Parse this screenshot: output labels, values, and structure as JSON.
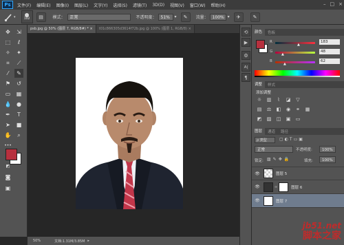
{
  "app": {
    "logo": "Ps"
  },
  "menu": [
    "文件(F)",
    "编辑(E)",
    "图像(I)",
    "图层(L)",
    "文字(Y)",
    "选择(S)",
    "滤镜(T)",
    "3D(D)",
    "视图(V)",
    "窗口(W)",
    "帮助(H)"
  ],
  "window_controls": [
    "–",
    "□",
    "×"
  ],
  "options": {
    "brush_size": "102",
    "mode_label": "模式：",
    "mode_value": "正常",
    "opacity_label": "不透明度：",
    "opacity_value": "51%",
    "flow_label": "流量：",
    "flow_value": "100%"
  },
  "tabs": [
    {
      "label": "psb.jpg @ 50% (图层 7, RGB/8#) *",
      "close": "×"
    },
    {
      "label": "t01c866305d3614f72b.jpg @ 100% (图层 1, RGB/8)",
      "close": "×"
    }
  ],
  "status": {
    "zoom": "50%",
    "doc": "文档:1.31M/3.85M"
  },
  "color_panel": {
    "tabs": [
      "颜色",
      "色板"
    ],
    "R": {
      "label": "R",
      "value": "183"
    },
    "G": {
      "label": "G",
      "value": "48"
    },
    "B": {
      "label": "B",
      "value": "62"
    },
    "foreground": "#b7303e"
  },
  "adjust_panel": {
    "tabs": [
      "调整",
      "样式"
    ],
    "title": "添加调整"
  },
  "layers_panel": {
    "tabs": [
      "图层",
      "通道",
      "路径"
    ],
    "kind_label": "ρ 类型",
    "blend_mode": "正常",
    "opacity_label": "不透明度:",
    "opacity_value": "100%",
    "lock_label": "锁定:",
    "fill_label": "填充:",
    "fill_value": "100%",
    "layers": [
      {
        "name": "图层 5"
      },
      {
        "name": "图层 6"
      },
      {
        "name": "图层 7"
      }
    ]
  },
  "watermark": {
    "line1": "jb51.net",
    "line2": "脚本之家"
  }
}
